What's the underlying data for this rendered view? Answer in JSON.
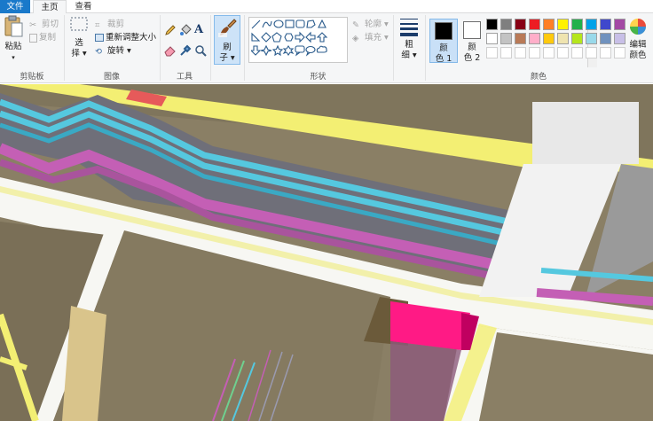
{
  "tabs": {
    "file": "文件",
    "home": "主页",
    "view": "查看"
  },
  "clipboard": {
    "paste": "粘贴",
    "cut": "剪切",
    "copy": "复制",
    "group": "剪贴板"
  },
  "image": {
    "select_line1": "选",
    "select_line2": "择",
    "crop": "裁剪",
    "resize": "重新调整大小",
    "rotate": "旋转",
    "group": "图像"
  },
  "tools": {
    "group": "工具"
  },
  "brushes": {
    "label_line1": "刷",
    "label_line2": "子"
  },
  "shapes": {
    "outline": "轮廓",
    "fill": "填充",
    "group": "形状"
  },
  "size": {
    "line1": "粗",
    "line2": "细"
  },
  "colors": {
    "color1_line1": "颜",
    "color1_line2": "色 1",
    "color2_line1": "颜",
    "color2_line2": "色 2",
    "edit_line1": "编辑",
    "edit_line2": "颜色",
    "group": "颜色",
    "color1_value": "#000000",
    "color2_value": "#ffffff",
    "row1": [
      "#000000",
      "#7f7f7f",
      "#880015",
      "#ed1c24",
      "#ff7f27",
      "#fff200",
      "#22b14c",
      "#00a2e8",
      "#3f48cc",
      "#a349a4"
    ],
    "row2": [
      "#ffffff",
      "#c3c3c3",
      "#b97a57",
      "#ffaec9",
      "#ffc90e",
      "#efe4b0",
      "#b5e61d",
      "#99d9ea",
      "#7092be",
      "#c8bfe7"
    ]
  },
  "icons": {
    "paste": "clipboard-icon",
    "cut": "scissors-icon",
    "copy": "copy-icon",
    "select": "marquee-icon",
    "crop": "crop-icon",
    "resize": "resize-icon",
    "rotate": "rotate-icon",
    "pencil": "pencil-icon",
    "fill": "bucket-icon",
    "text": "text-icon",
    "eraser": "eraser-icon",
    "picker": "color-picker-icon",
    "magnifier": "magnifier-icon",
    "brush": "brush-icon",
    "size": "line-width-icon"
  }
}
